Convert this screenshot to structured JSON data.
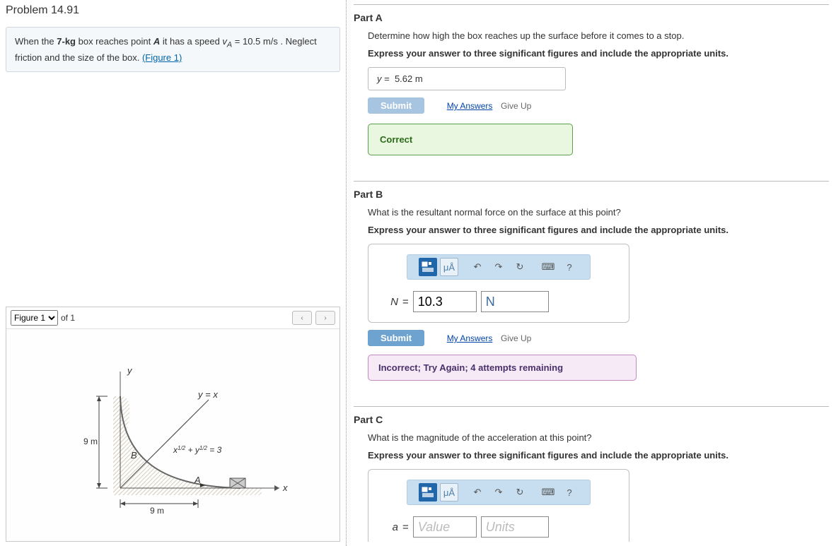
{
  "problem": {
    "title": "Problem 14.91",
    "statement_pre": "When the ",
    "mass": "7-kg",
    "statement_mid1": " box reaches point ",
    "point": "A",
    "statement_mid2": " it has a speed ",
    "speed_sym": "vA",
    "speed_val": " = 10.5  m/s",
    "statement_post": " . Neglect friction and the size of the box. ",
    "figure_link": "(Figure 1)"
  },
  "figure": {
    "selector": "Figure 1",
    "of_label": "of 1",
    "curve_label": "x1/2 + y1/2 = 3",
    "line_label": "y = x",
    "dim_h": "9 m",
    "dim_w": "9 m",
    "axis_y": "y",
    "axis_x": "x",
    "point_A": "A",
    "point_B": "B"
  },
  "nav": {
    "prev": "‹",
    "next": "›"
  },
  "partA": {
    "heading": "Part A",
    "question": "Determine how high the box reaches up the surface before it comes to a stop.",
    "instruct": "Express your answer to three significant figures and include the appropriate units.",
    "var": "y",
    "eq": " = ",
    "value": "5.62 m",
    "submit": "Submit",
    "myans": "My Answers",
    "giveup": "Give Up",
    "feedback": "Correct"
  },
  "partB": {
    "heading": "Part B",
    "question": "What is the resultant normal force on the surface at this point?",
    "instruct": "Express your answer to three significant figures and include the appropriate units.",
    "var": "N",
    "eq": " = ",
    "value": "10.3",
    "units": "N",
    "submit": "Submit",
    "myans": "My Answers",
    "giveup": "Give Up",
    "feedback": "Incorrect; Try Again; 4 attempts remaining"
  },
  "partC": {
    "heading": "Part C",
    "question": "What is the magnitude of the acceleration at this point?",
    "instruct": "Express your answer to three significant figures and include the appropriate units.",
    "var": "a",
    "eq": " = ",
    "value_ph": "Value",
    "units_ph": "Units"
  },
  "toolbar": {
    "templates": "T",
    "greek": "μÅ",
    "undo": "↶",
    "redo": "↷",
    "reset": "↻",
    "keyboard": "⌨",
    "help": "?"
  }
}
